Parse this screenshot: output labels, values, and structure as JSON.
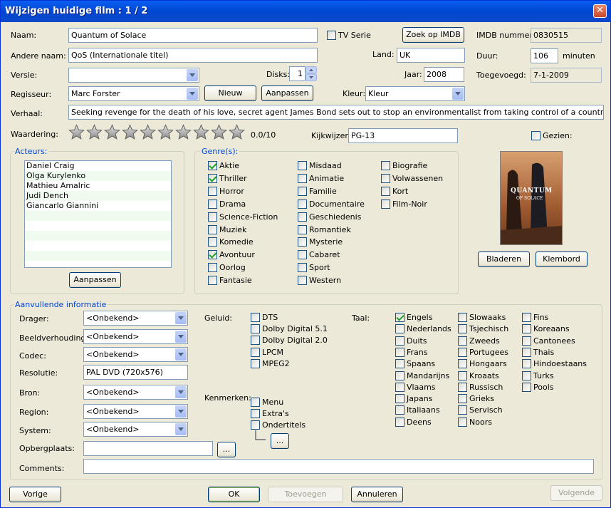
{
  "window": {
    "title": "Wijzigen huidige film : 1 / 2"
  },
  "main": {
    "naam_label": "Naam:",
    "naam": "Quantum of Solace",
    "tvserie_label": "TV Serie",
    "zoek_imdb": "Zoek op IMDB",
    "imdb_label": "IMDB nummer:",
    "imdb": "0830515",
    "andere_naam_label": "Andere naam:",
    "andere_naam": "QoS (Internationale titel)",
    "land_label": "Land:",
    "land": "UK",
    "duur_label": "Duur:",
    "duur": "106",
    "duur_unit": "minuten",
    "versie_label": "Versie:",
    "versie": "",
    "disks_label": "Disks:",
    "disks": "1",
    "jaar_label": "Jaar:",
    "jaar": "2008",
    "toegevoegd_label": "Toegevoegd:",
    "toegevoegd": "7-1-2009",
    "regisseur_label": "Regisseur:",
    "regisseur": "Marc Forster",
    "nieuw": "Nieuw",
    "aanpassen": "Aanpassen",
    "kleur_label": "Kleur:",
    "kleur": "Kleur",
    "verhaal_label": "Verhaal:",
    "verhaal": "Seeking revenge for the death of his love, secret agent James Bond sets out to stop an environmentalist from taking control of a country's valuable resource.",
    "waardering_label": "Waardering:",
    "waardering_value": "0.0/10",
    "rating": 0,
    "rating_max": 10,
    "kijkwijzer_label": "Kijkwijzer:",
    "kijkwijzer": "PG-13",
    "gezien_label": "Gezien:"
  },
  "actors": {
    "label": "Acteurs:",
    "items": [
      "Daniel Craig",
      "Olga Kurylenko",
      "Mathieu Amalric",
      "Judi Dench",
      "Giancarlo Giannini"
    ],
    "button": "Aanpassen"
  },
  "genres": {
    "label": "Genre(s):",
    "col1": [
      {
        "label": "Aktie",
        "checked": true
      },
      {
        "label": "Thriller",
        "checked": true
      },
      {
        "label": "Horror",
        "checked": false
      },
      {
        "label": "Drama",
        "checked": false
      },
      {
        "label": "Science-Fiction",
        "checked": false
      },
      {
        "label": "Muziek",
        "checked": false
      },
      {
        "label": "Komedie",
        "checked": false
      },
      {
        "label": "Avontuur",
        "checked": true
      },
      {
        "label": "Oorlog",
        "checked": false
      },
      {
        "label": "Fantasie",
        "checked": false
      }
    ],
    "col2": [
      {
        "label": "Misdaad",
        "checked": false
      },
      {
        "label": "Animatie",
        "checked": false
      },
      {
        "label": "Familie",
        "checked": false
      },
      {
        "label": "Documentaire",
        "checked": false
      },
      {
        "label": "Geschiedenis",
        "checked": false
      },
      {
        "label": "Romantiek",
        "checked": false
      },
      {
        "label": "Mysterie",
        "checked": false
      },
      {
        "label": "Cabaret",
        "checked": false
      },
      {
        "label": "Sport",
        "checked": false
      },
      {
        "label": "Western",
        "checked": false
      }
    ],
    "col3": [
      {
        "label": "Biografie",
        "checked": false
      },
      {
        "label": "Volwassenen",
        "checked": false
      },
      {
        "label": "Kort",
        "checked": false
      },
      {
        "label": "Film-Noir",
        "checked": false
      }
    ]
  },
  "poster": {
    "title_text": "QUANTUM",
    "sub_text": "OF SOLACE",
    "bladeren": "Bladeren",
    "klembord": "Klembord"
  },
  "extra": {
    "label": "Aanvullende informatie",
    "drager_label": "Drager:",
    "drager": "<Onbekend>",
    "beeld_label": "Beeldverhouding:",
    "beeld": "<Onbekend>",
    "codec_label": "Codec:",
    "codec": "<Onbekend>",
    "resolutie_label": "Resolutie:",
    "resolutie": "PAL DVD (720x576)",
    "bron_label": "Bron:",
    "bron": "<Onbekend>",
    "region_label": "Region:",
    "region": "<Onbekend>",
    "system_label": "System:",
    "system": "<Onbekend>",
    "opberg_label": "Opbergplaats:",
    "opberg": "",
    "opberg_btn": "...",
    "comments_label": "Comments:",
    "comments": "",
    "geluid_label": "Geluid:",
    "geluid": [
      {
        "label": "DTS",
        "checked": false
      },
      {
        "label": "Dolby Digital 5.1",
        "checked": false
      },
      {
        "label": "Dolby Digital 2.0",
        "checked": false
      },
      {
        "label": "LPCM",
        "checked": false
      },
      {
        "label": "MPEG2",
        "checked": false
      }
    ],
    "kenmerken_label": "Kenmerken:",
    "kenmerken": [
      {
        "label": "Menu",
        "checked": false
      },
      {
        "label": "Extra's",
        "checked": false
      },
      {
        "label": "Ondertitels",
        "checked": false
      }
    ],
    "kenmerken_btn": "...",
    "taal_label": "Taal:",
    "taal_col1": [
      {
        "label": "Engels",
        "checked": true
      },
      {
        "label": "Nederlands",
        "checked": false
      },
      {
        "label": "Duits",
        "checked": false
      },
      {
        "label": "Frans",
        "checked": false
      },
      {
        "label": "Spaans",
        "checked": false
      },
      {
        "label": "Mandarijns",
        "checked": false
      },
      {
        "label": "Vlaams",
        "checked": false
      },
      {
        "label": "Japans",
        "checked": false
      },
      {
        "label": "Italiaans",
        "checked": false
      },
      {
        "label": "Deens",
        "checked": false
      }
    ],
    "taal_col2": [
      {
        "label": "Slowaaks",
        "checked": false
      },
      {
        "label": "Tsjechisch",
        "checked": false
      },
      {
        "label": "Zweeds",
        "checked": false
      },
      {
        "label": "Portugees",
        "checked": false
      },
      {
        "label": "Hongaars",
        "checked": false
      },
      {
        "label": "Kroaats",
        "checked": false
      },
      {
        "label": "Russisch",
        "checked": false
      },
      {
        "label": "Grieks",
        "checked": false
      },
      {
        "label": "Servisch",
        "checked": false
      },
      {
        "label": "Noors",
        "checked": false
      }
    ],
    "taal_col3": [
      {
        "label": "Fins",
        "checked": false
      },
      {
        "label": "Koreaans",
        "checked": false
      },
      {
        "label": "Cantonees",
        "checked": false
      },
      {
        "label": "Thais",
        "checked": false
      },
      {
        "label": "Hindoestaans",
        "checked": false
      },
      {
        "label": "Turks",
        "checked": false
      },
      {
        "label": "Pools",
        "checked": false
      }
    ]
  },
  "footer": {
    "vorige": "Vorige",
    "ok": "OK",
    "toevoegen": "Toevoegen",
    "annuleren": "Annuleren",
    "volgende": "Volgende"
  },
  "colors": {
    "title_bar": "#0247d2",
    "group_label": "#0046d5",
    "check": "#21a121"
  }
}
